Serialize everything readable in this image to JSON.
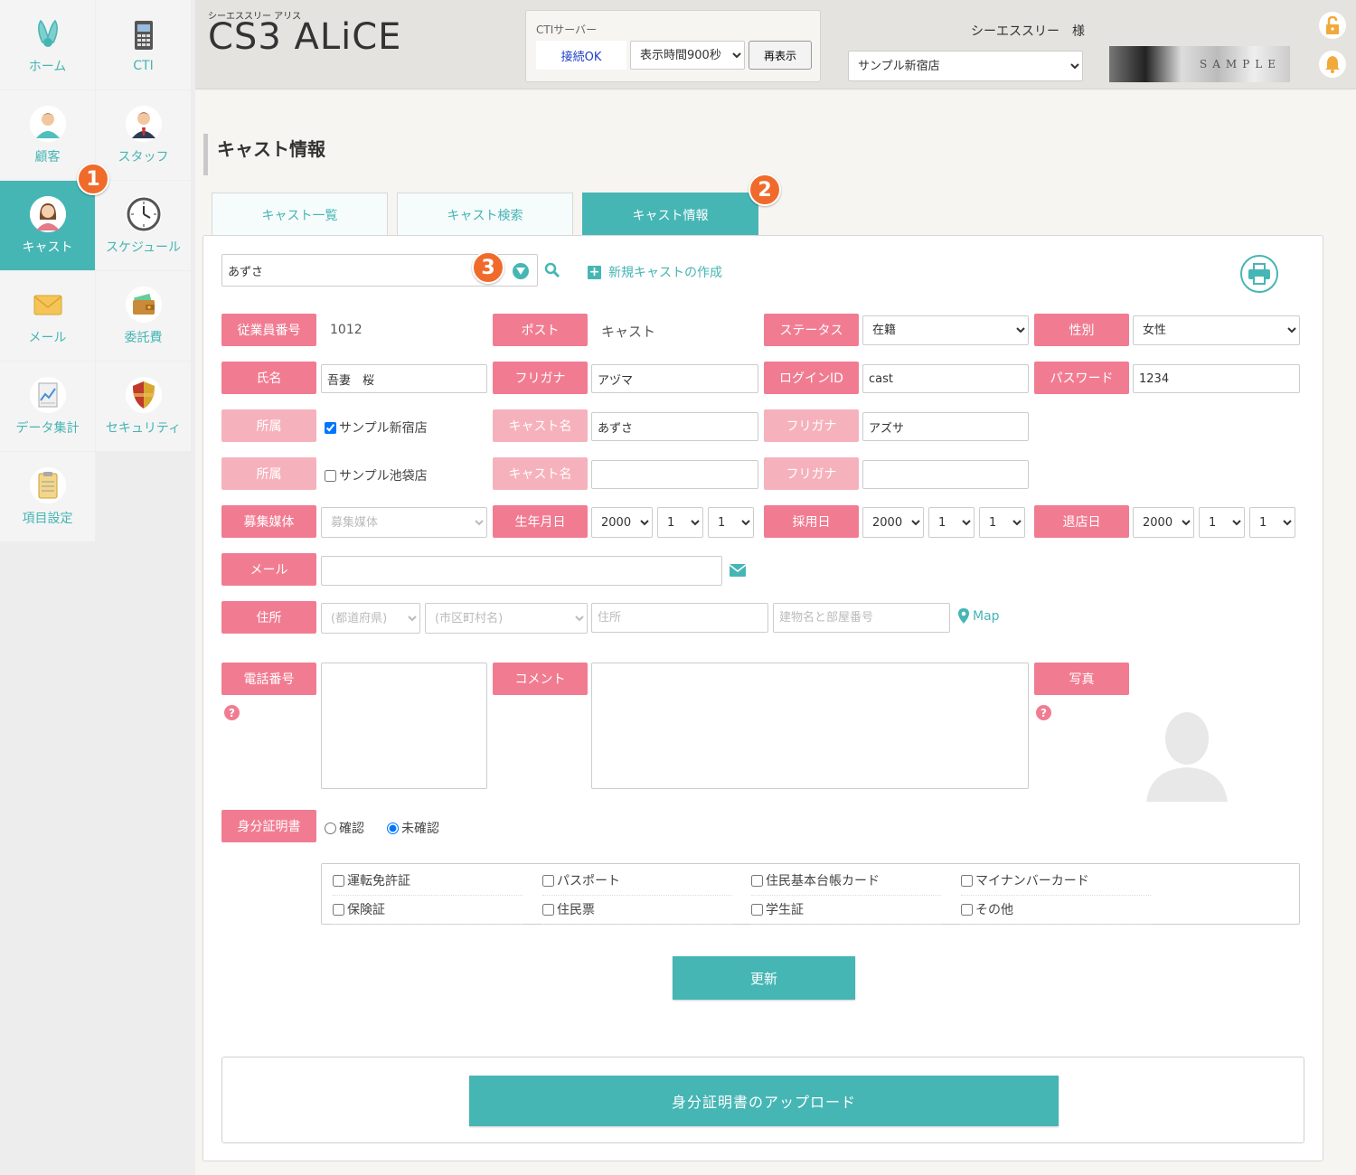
{
  "sidebar": {
    "items": [
      {
        "label": "ホーム",
        "icon": "rabbit-icon",
        "active": false
      },
      {
        "label": "CTI",
        "icon": "phone-icon",
        "active": false
      },
      {
        "label": "顧客",
        "icon": "customer-icon",
        "active": false
      },
      {
        "label": "スタッフ",
        "icon": "staff-icon",
        "active": false
      },
      {
        "label": "キャスト",
        "icon": "cast-icon",
        "active": true
      },
      {
        "label": "スケジュール",
        "icon": "clock-icon",
        "active": false
      },
      {
        "label": "メール",
        "icon": "mail-icon",
        "active": false
      },
      {
        "label": "委託費",
        "icon": "wallet-icon",
        "active": false
      },
      {
        "label": "データ集計",
        "icon": "chart-icon",
        "active": false
      },
      {
        "label": "セキュリティ",
        "icon": "shield-icon",
        "active": false
      },
      {
        "label": "項目設定",
        "icon": "clipboard-icon",
        "active": false
      }
    ]
  },
  "header": {
    "brand_sub": "シーエススリー アリス",
    "brand": "CS3 ALiCE",
    "cti_title": "CTIサーバー",
    "cti_status": "接続OK",
    "cti_display_time": "表示時間900秒",
    "cti_reload": "再表示",
    "user_name": "シーエススリー　様",
    "store": "サンプル新宿店",
    "banner_text": "SAMPLE"
  },
  "badges": {
    "b1": "1",
    "b2": "2",
    "b3": "3"
  },
  "page_title": "キャスト情報",
  "tabs": [
    {
      "label": "キャスト一覧",
      "active": false
    },
    {
      "label": "キャスト検索",
      "active": false
    },
    {
      "label": "キャスト情報",
      "active": true
    }
  ],
  "search": {
    "value": "あずさ",
    "new_cast": "新規キャストの作成"
  },
  "form": {
    "employee_no_label": "従業員番号",
    "employee_no": "1012",
    "post_label": "ポスト",
    "post": "キャスト",
    "status_label": "ステータス",
    "status": "在籍",
    "gender_label": "性別",
    "gender": "女性",
    "name_label": "氏名",
    "name": "吾妻　桜",
    "furigana_label": "フリガナ",
    "furigana": "アヅマ",
    "login_label": "ログインID",
    "login": "cast",
    "password_label": "パスワード",
    "password": "1234",
    "affil_label": "所属",
    "affil1": "サンプル新宿店",
    "affil1_checked": true,
    "cast_name_label": "キャスト名",
    "cast_name1": "あずさ",
    "cast_furigana_label": "フリガナ",
    "cast_furigana1": "アズサ",
    "affil2": "サンプル池袋店",
    "affil2_checked": false,
    "cast_name2": "",
    "cast_furigana2": "",
    "media_label": "募集媒体",
    "media_placeholder": "募集媒体",
    "birth_label": "生年月日",
    "birth_y": "2000",
    "birth_m": "1",
    "birth_d": "1",
    "hire_label": "採用日",
    "hire_y": "2000",
    "hire_m": "1",
    "hire_d": "1",
    "leave_label": "退店日",
    "leave_y": "2000",
    "leave_m": "1",
    "leave_d": "1",
    "mail_label": "メール",
    "mail": "",
    "address_label": "住所",
    "pref_placeholder": "(都道府県)",
    "city_placeholder": "(市区町村名)",
    "addr_placeholder": "住所",
    "building_placeholder": "建物名と部屋番号",
    "map_label": "Map",
    "phone_label": "電話番号",
    "comment_label": "コメント",
    "photo_label": "写真",
    "id_label": "身分証明書",
    "id_confirmed": "確認",
    "id_unconfirmed": "未確認",
    "id_types": [
      "運転免許証",
      "パスポート",
      "住民基本台帳カード",
      "マイナンバーカード",
      "保険証",
      "住民票",
      "学生証",
      "その他"
    ],
    "update_button": "更新",
    "upload_button": "身分証明書のアップロード"
  },
  "colors": {
    "teal": "#46b6b5",
    "pink": "#f17c92",
    "pink_light": "#f6b2bc",
    "badge": "#f06b2b"
  }
}
